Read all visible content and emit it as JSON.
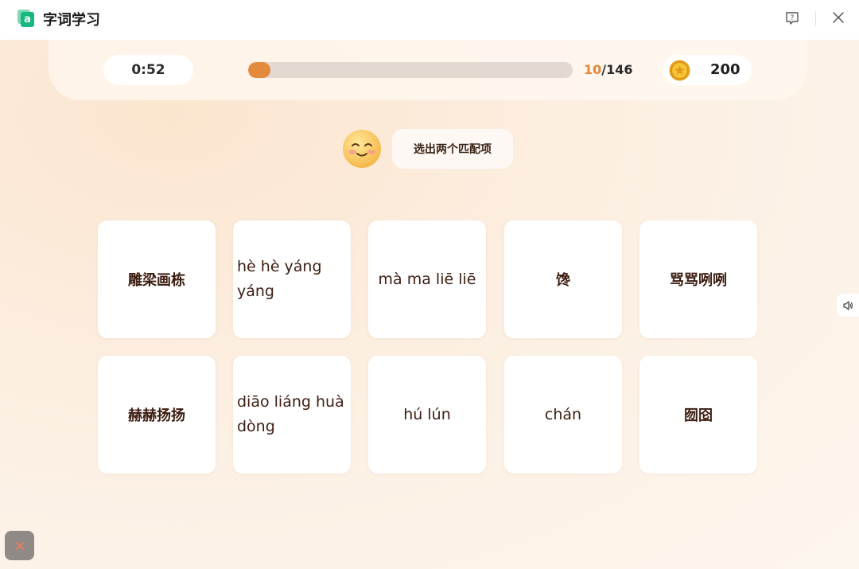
{
  "app": {
    "logo_letter": "a",
    "title": "字词学习"
  },
  "status": {
    "timer": "0:52",
    "progress_current": "10",
    "progress_total": "/146",
    "progress_fraction": 0.0685,
    "coins": "200"
  },
  "instruction": "选出两个匹配项",
  "cards": [
    {
      "text": "雕梁画栋",
      "kind": "hanzi"
    },
    {
      "text": "hè hè yáng yáng",
      "kind": "pinyin"
    },
    {
      "text": "mà ma liē liē",
      "kind": "pinyin"
    },
    {
      "text": "馋",
      "kind": "hanzi"
    },
    {
      "text": "骂骂咧咧",
      "kind": "hanzi"
    },
    {
      "text": "赫赫扬扬",
      "kind": "hanzi"
    },
    {
      "text": "diāo liáng huà dòng",
      "kind": "pinyin"
    },
    {
      "text": "hú lún",
      "kind": "pinyin"
    },
    {
      "text": "chán",
      "kind": "pinyin"
    },
    {
      "text": "囫囵",
      "kind": "hanzi"
    }
  ],
  "icons": {
    "help": "help-icon",
    "close": "close-icon",
    "coin": "coin-icon",
    "mascot": "smiley-face-icon",
    "sound": "speaker-icon",
    "quit": "x-icon"
  },
  "colors": {
    "accent": "#e48a3c",
    "brand_green": "#16b87f",
    "card_text": "#3c1c10",
    "quit_x": "#f07b5e"
  }
}
